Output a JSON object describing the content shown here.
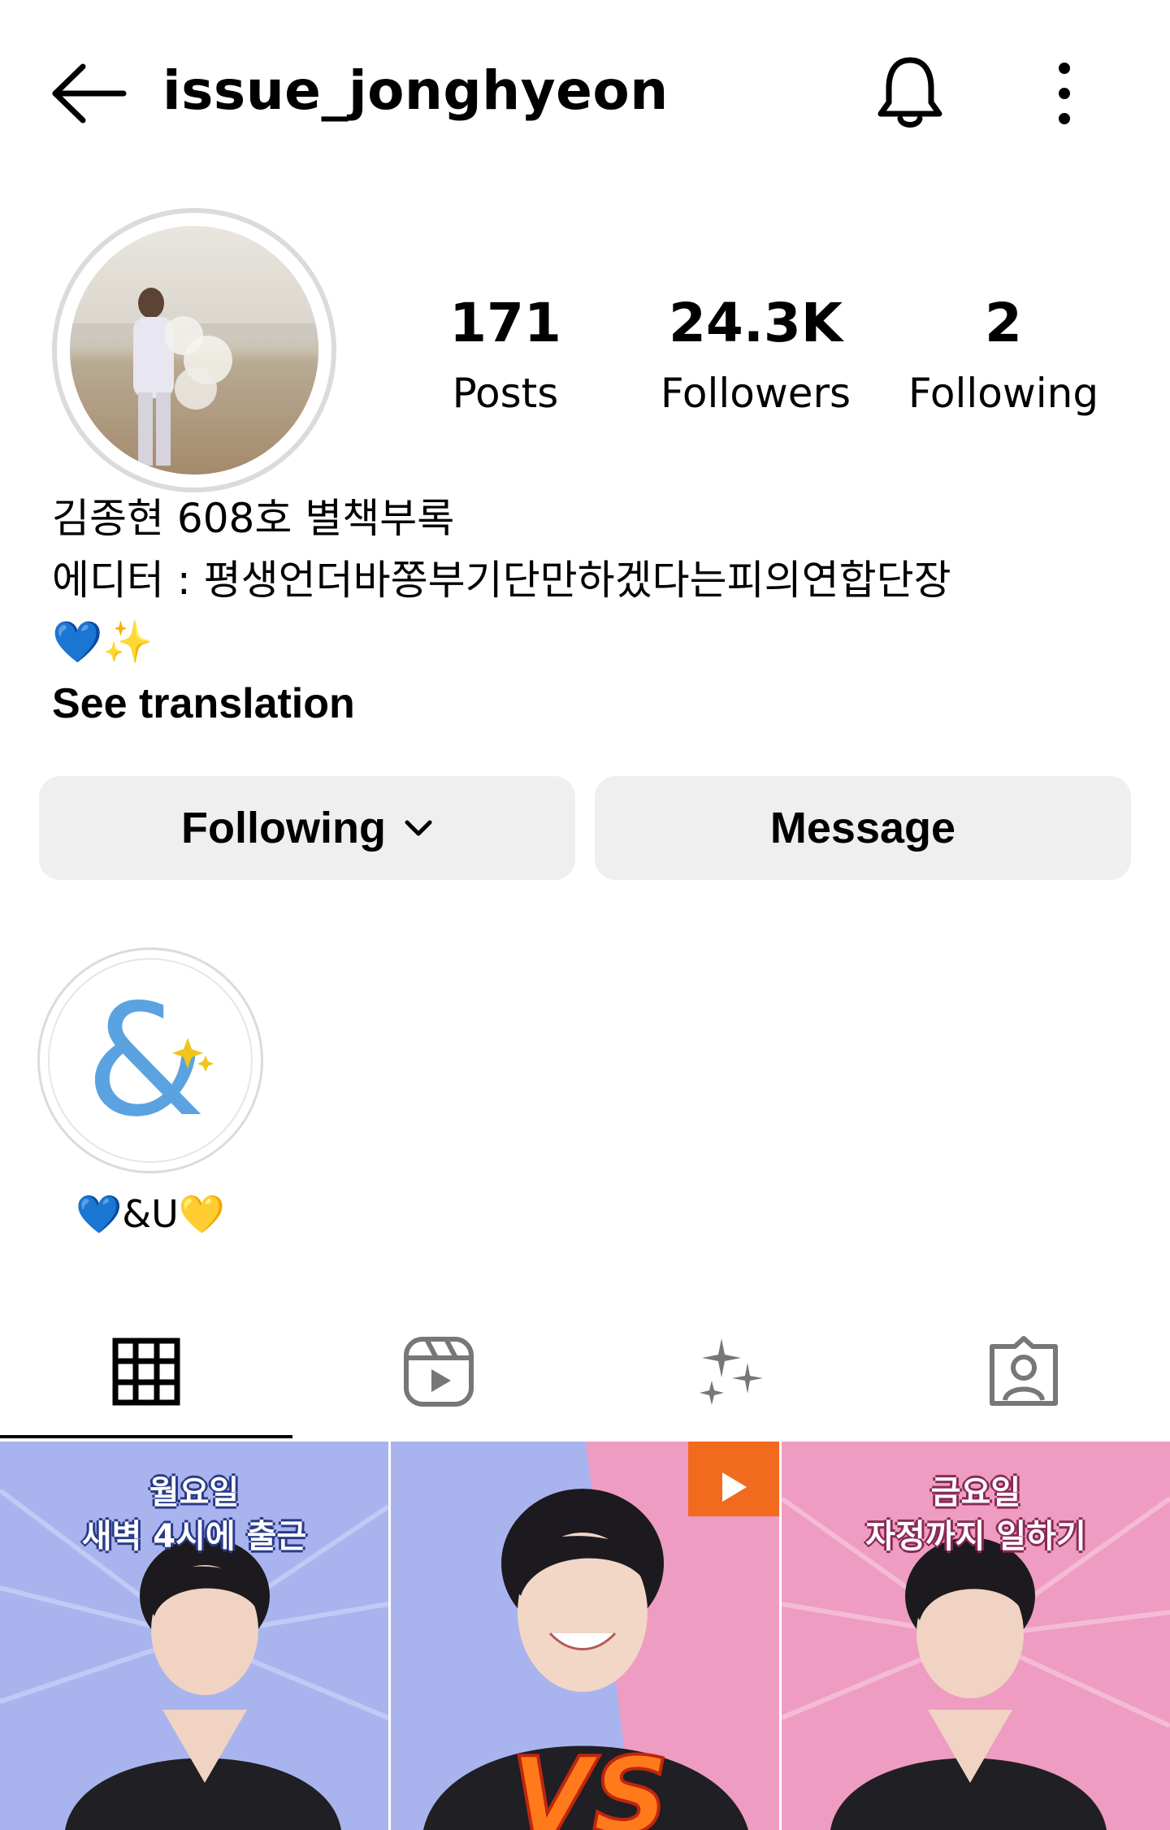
{
  "header": {
    "username": "issue_jonghyeon",
    "back_icon": "arrow-left-icon",
    "bell_icon": "bell-icon",
    "more_icon": "more-vertical-icon"
  },
  "profile": {
    "stats": {
      "posts_count": "171",
      "posts_label": "Posts",
      "followers_count": "24.3K",
      "followers_label": "Followers",
      "following_count": "2",
      "following_label": "Following"
    },
    "bio": {
      "line1": "김종현 608호 별책부록",
      "line2": "에디터 : 평생언더바쫑부기단만하겠다는피의연합단장",
      "line3": "💙✨",
      "see_translation": "See translation"
    }
  },
  "actions": {
    "following_label": "Following",
    "message_label": "Message"
  },
  "highlights": [
    {
      "label": "💙&U💛",
      "icon": "ampersand-sparkle-icon"
    }
  ],
  "tabs": [
    {
      "name": "posts",
      "icon": "grid-icon",
      "active": true
    },
    {
      "name": "reels",
      "icon": "reels-icon",
      "active": false
    },
    {
      "name": "ai-sparkle",
      "icon": "sparkles-icon",
      "active": false
    },
    {
      "name": "tagged",
      "icon": "tagged-person-icon",
      "active": false
    }
  ],
  "grid": {
    "post1_caption_l1": "월요일",
    "post1_caption_l2": "새벽 4시에 출근",
    "post2_badge": "VS",
    "post3_caption_l1": "금요일",
    "post3_caption_l2": "자정까지 일하기"
  },
  "colors": {
    "button_bg": "#efefef",
    "post_blue": "#a9b4ee",
    "post_pink": "#ef9cc2",
    "badge_orange": "#f26a1e",
    "highlight_blue": "#5aa3e0"
  }
}
